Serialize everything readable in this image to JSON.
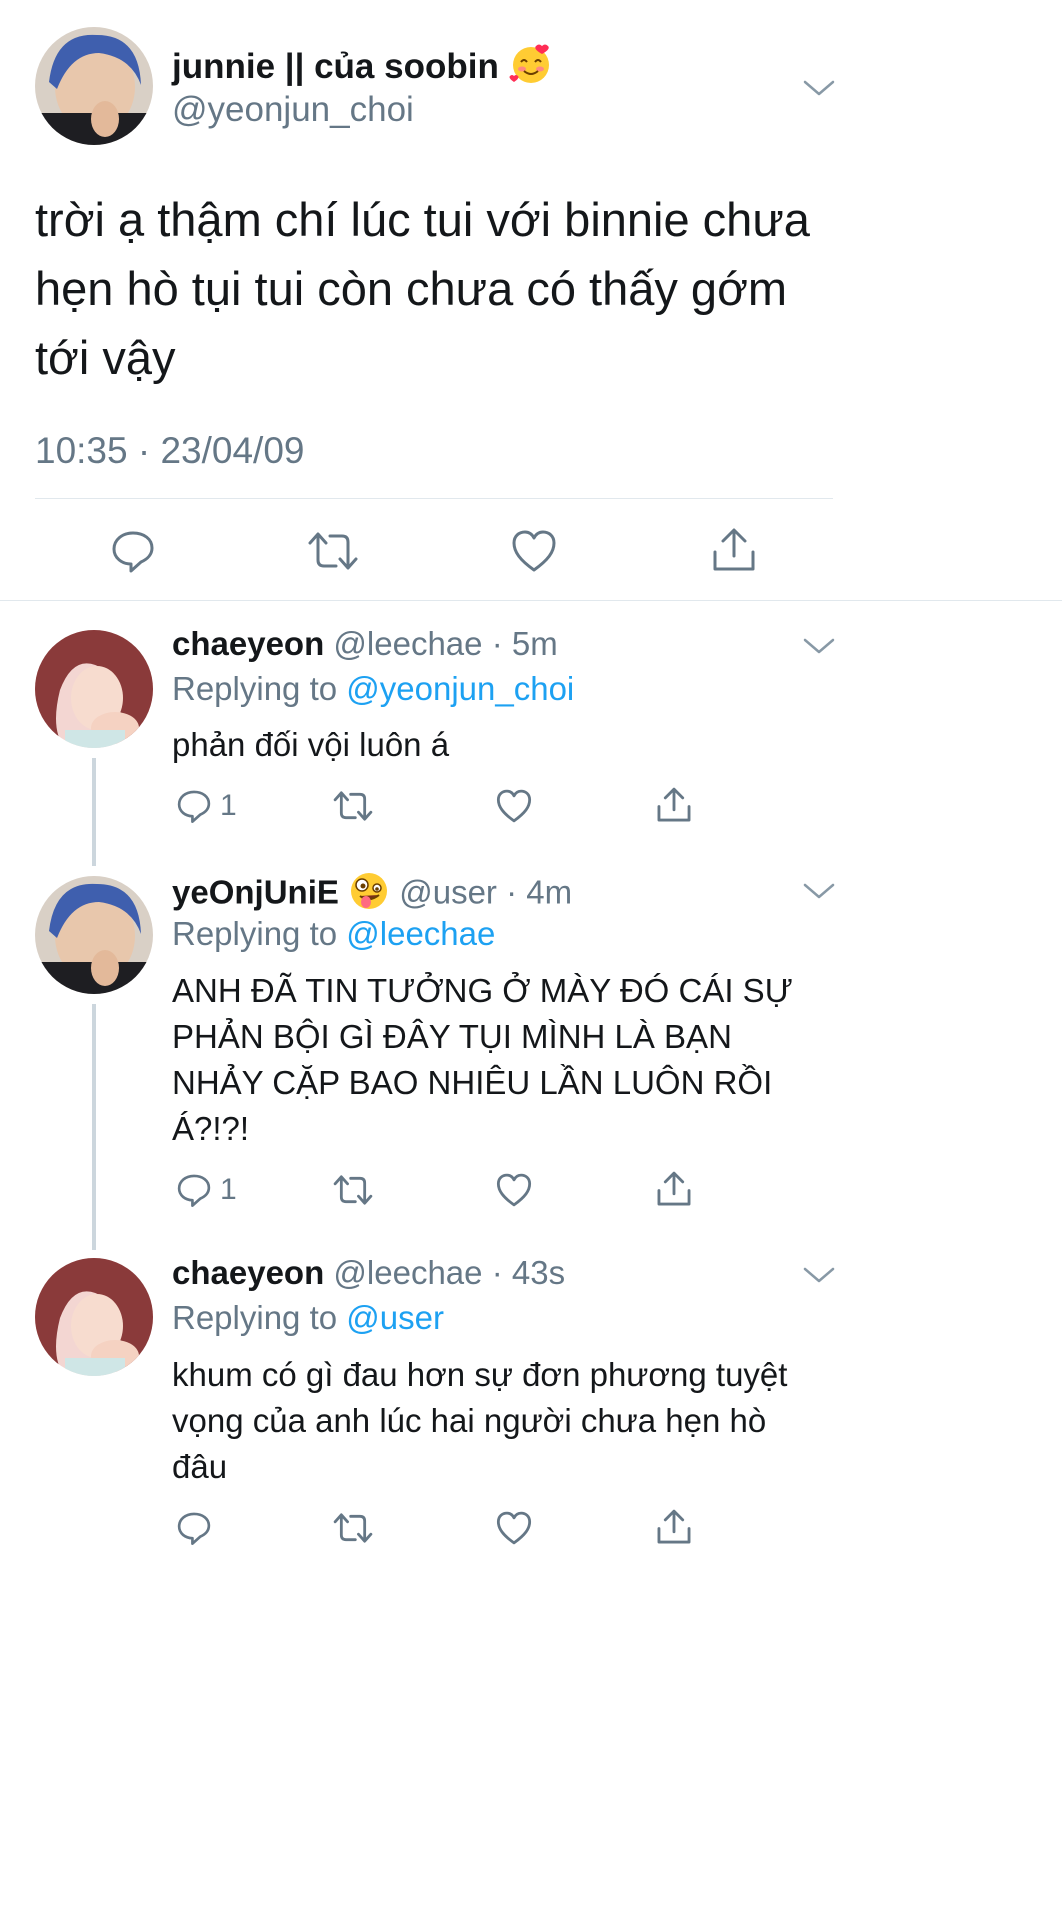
{
  "main_tweet": {
    "display_name": "junnie || của soobin",
    "emoji": "smiling-face-with-hearts",
    "handle": "@yeonjun_choi",
    "text_lines": [
      "trời ạ thậm chí lúc tui với binnie chưa",
      "hẹn hò tụi tui còn chưa có thấy gớm",
      "tới vậy"
    ],
    "timestamp": "10:35 · 23/04/09"
  },
  "replies": [
    {
      "display_name": "chaeyeon",
      "handle": "@leechae",
      "time": "· 5m",
      "replying_prefix": "Replying to ",
      "replying_to": "@yeonjun_choi",
      "text_lines": [
        "phản đối vội luôn á"
      ],
      "reply_count": "1"
    },
    {
      "display_name": "yeOnjUniE",
      "emoji": "zany-face",
      "handle": "@user",
      "time": "· 4m",
      "replying_prefix": "Replying to ",
      "replying_to": "@leechae",
      "text_lines": [
        "ANH ĐÃ TIN TƯỞNG Ở MÀY ĐÓ CÁI SỰ",
        "PHẢN BỘI GÌ ĐÂY TỤI MÌNH LÀ BẠN",
        "NHẢY CẶP BAO NHIÊU LẦN LUÔN RỒI",
        "Á?!?!"
      ],
      "reply_count": "1"
    },
    {
      "display_name": "chaeyeon",
      "handle": "@leechae",
      "time": "· 43s",
      "replying_prefix": "Replying to ",
      "replying_to": "@user",
      "text_lines": [
        "khum có gì đau hơn sự đơn phương tuyệt",
        "vọng của anh lúc hai người chưa hẹn hò",
        "đâu"
      ],
      "reply_count": ""
    }
  ],
  "colors": {
    "text": "#14171a",
    "secondary": "#657786",
    "link": "#1da1f2",
    "divider": "#e1e8ed",
    "thread_line": "#ccd6dd"
  },
  "icons": [
    "reply-icon",
    "retweet-icon",
    "like-icon",
    "share-icon",
    "chevron-down-icon"
  ]
}
